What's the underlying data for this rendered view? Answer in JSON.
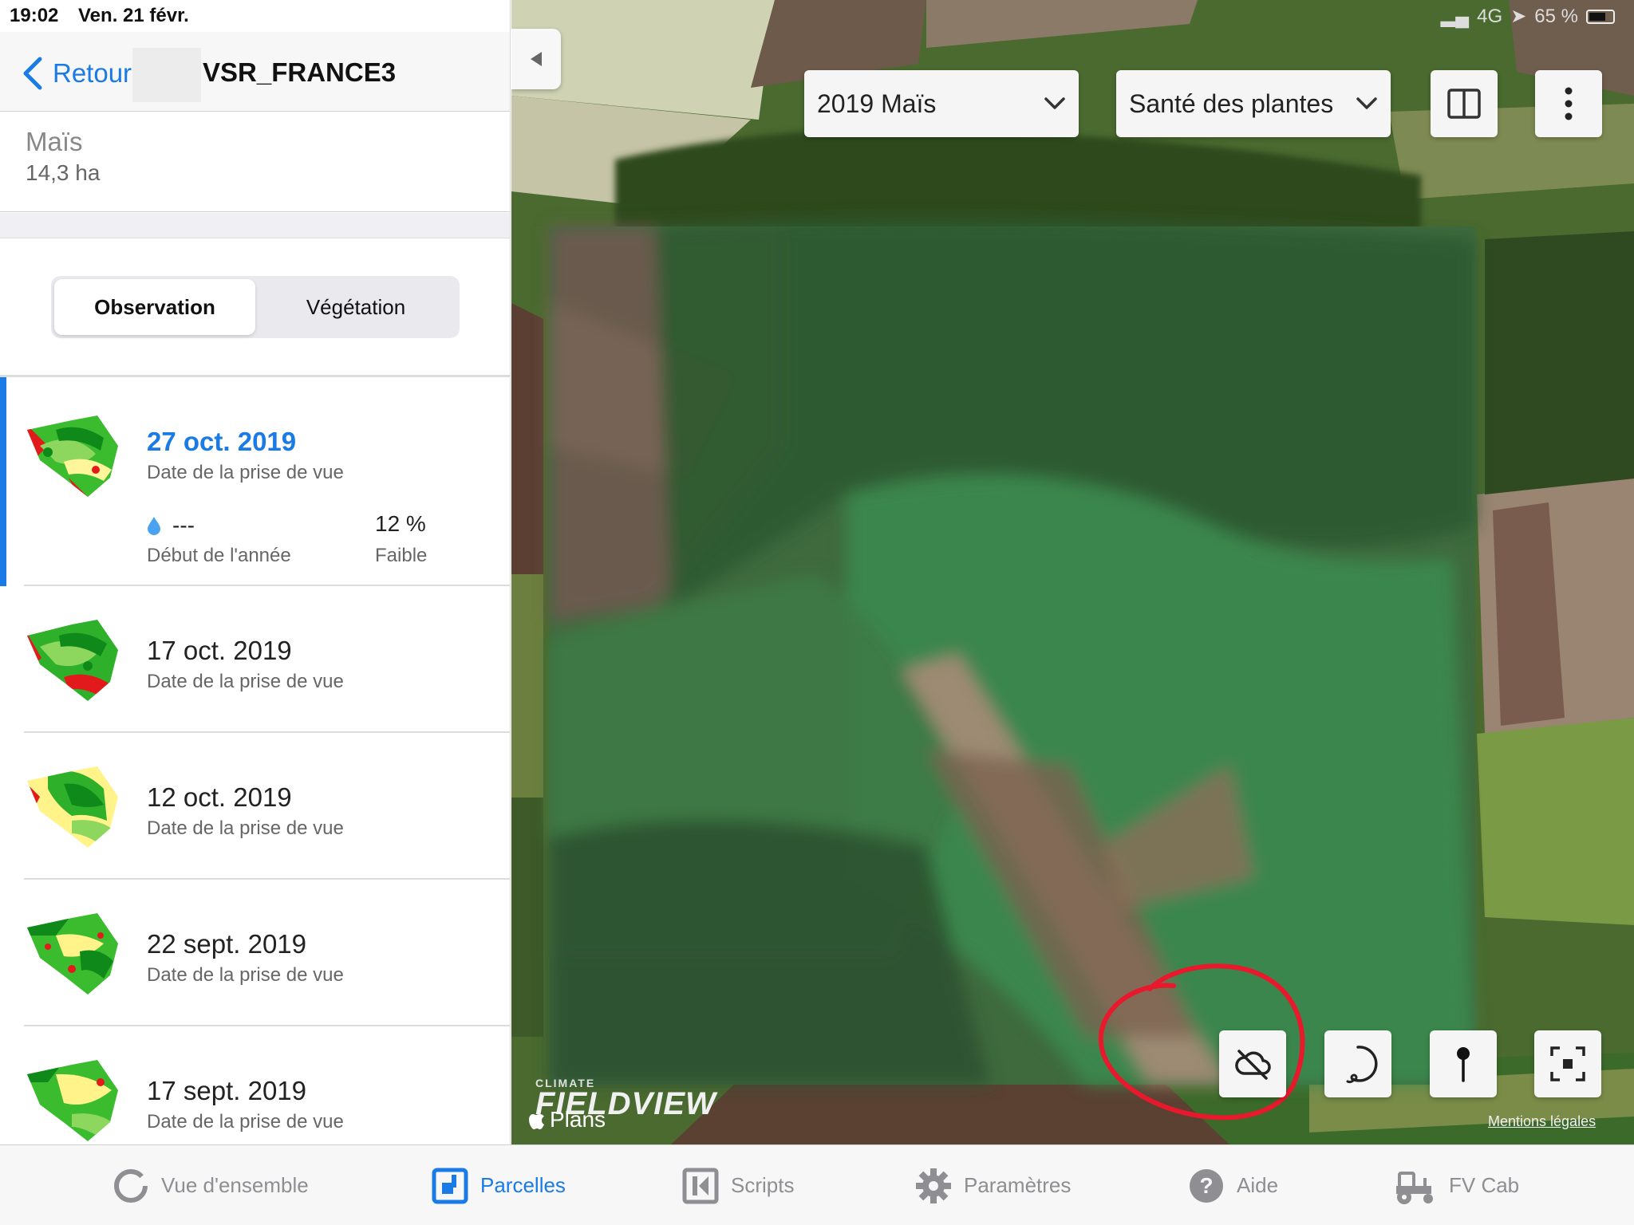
{
  "status_bar": {
    "time": "19:02",
    "date": "Ven. 21 févr.",
    "network": "4G",
    "battery": "65 %"
  },
  "nav": {
    "back_label": "Retour",
    "title": "VSR_FRANCE3"
  },
  "crop": {
    "name": "Maïs",
    "area": "14,3 ha"
  },
  "segments": [
    {
      "label": "Observation",
      "active": true
    },
    {
      "label": "Végétation",
      "active": false
    }
  ],
  "observations": [
    {
      "date": "27 oct. 2019",
      "label": "Date de la prise de vue",
      "moisture_value": "---",
      "moisture_label": "Début de l'année",
      "percent": "12 %",
      "percent_label": "Faible",
      "selected": true
    },
    {
      "date": "17 oct. 2019",
      "label": "Date de la prise de vue"
    },
    {
      "date": "12 oct. 2019",
      "label": "Date de la prise de vue"
    },
    {
      "date": "22 sept. 2019",
      "label": "Date de la prise de vue"
    },
    {
      "date": "17 sept. 2019",
      "label": "Date de la prise de vue"
    }
  ],
  "map": {
    "season": "2019 Maïs",
    "layer": "Santé des plantes",
    "logo_small": "CLIMATE",
    "logo_big": "FIELDVIEW",
    "plans_label": "Plans",
    "legal": "Mentions légales"
  },
  "tabs": [
    {
      "label": "Vue d'ensemble",
      "icon": "overview-ring-icon",
      "active": false
    },
    {
      "label": "Parcelles",
      "icon": "fields-icon",
      "active": true
    },
    {
      "label": "Scripts",
      "icon": "scripts-icon",
      "active": false
    },
    {
      "label": "Paramètres",
      "icon": "gear-icon",
      "active": false
    },
    {
      "label": "Aide",
      "icon": "help-icon",
      "active": false
    },
    {
      "label": "FV Cab",
      "icon": "tractor-icon",
      "active": false
    }
  ],
  "colors": {
    "accent": "#1a7ae6",
    "annotation_circle": "#e8192c"
  }
}
